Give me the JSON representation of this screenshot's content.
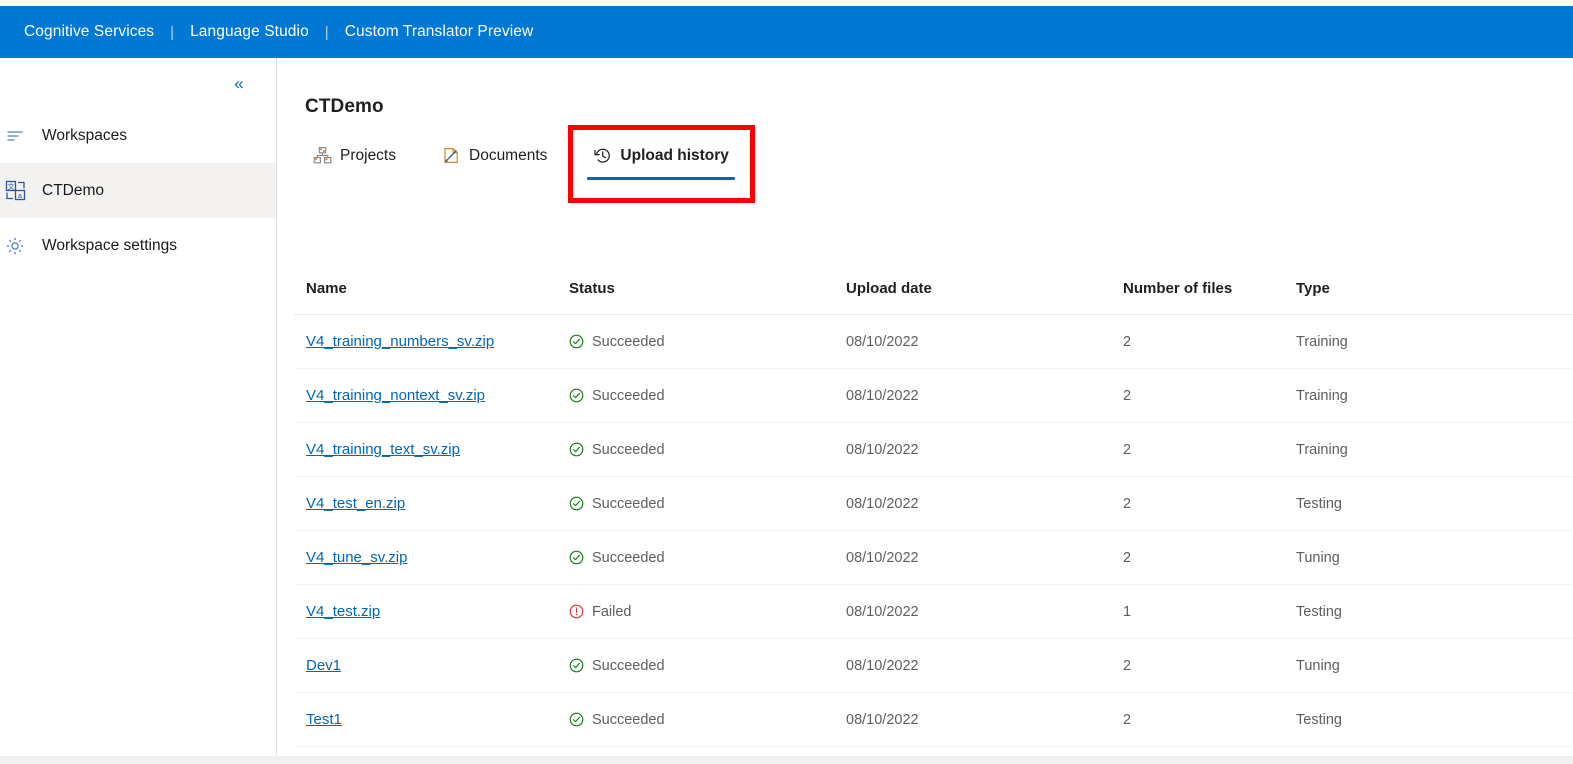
{
  "topbar": {
    "links": [
      "Cognitive Services",
      "Language Studio",
      "Custom Translator Preview"
    ],
    "separator": "|",
    "background": "#0078d4",
    "text_color": "#ffffff"
  },
  "sidebar": {
    "collapse_glyph": "«",
    "items": [
      {
        "label": "Workspaces",
        "icon": "list-icon",
        "selected": false
      },
      {
        "label": "CTDemo",
        "icon": "translate-icon",
        "selected": true
      },
      {
        "label": "Workspace settings",
        "icon": "gear-icon",
        "selected": false
      }
    ]
  },
  "main": {
    "title": "CTDemo",
    "tabs": [
      {
        "label": "Projects",
        "icon": "projects-icon",
        "active": false
      },
      {
        "label": "Documents",
        "icon": "documents-icon",
        "active": false
      },
      {
        "label": "Upload history",
        "icon": "history-icon",
        "active": true
      }
    ],
    "annotation": {
      "color": "#fe0000",
      "target": "Upload history"
    },
    "accent_color": "#0067b8",
    "table": {
      "columns": [
        "Name",
        "Status",
        "Upload date",
        "Number of files",
        "Type"
      ],
      "rows": [
        {
          "name": "V4_training_numbers_sv.zip",
          "status": "Succeeded",
          "status_icon": "check-circle-icon",
          "date": "08/10/2022",
          "files": "2",
          "type": "Training"
        },
        {
          "name": "V4_training_nontext_sv.zip",
          "status": "Succeeded",
          "status_icon": "check-circle-icon",
          "date": "08/10/2022",
          "files": "2",
          "type": "Training"
        },
        {
          "name": "V4_training_text_sv.zip",
          "status": "Succeeded",
          "status_icon": "check-circle-icon",
          "date": "08/10/2022",
          "files": "2",
          "type": "Training"
        },
        {
          "name": "V4_test_en.zip",
          "status": "Succeeded",
          "status_icon": "check-circle-icon",
          "date": "08/10/2022",
          "files": "2",
          "type": "Testing"
        },
        {
          "name": "V4_tune_sv.zip",
          "status": "Succeeded",
          "status_icon": "check-circle-icon",
          "date": "08/10/2022",
          "files": "2",
          "type": "Tuning"
        },
        {
          "name": "V4_test.zip",
          "status": "Failed",
          "status_icon": "error-circle-icon",
          "date": "08/10/2022",
          "files": "1",
          "type": "Testing"
        },
        {
          "name": "Dev1",
          "status": "Succeeded",
          "status_icon": "check-circle-icon",
          "date": "08/10/2022",
          "files": "2",
          "type": "Tuning"
        },
        {
          "name": "Test1",
          "status": "Succeeded",
          "status_icon": "check-circle-icon",
          "date": "08/10/2022",
          "files": "2",
          "type": "Testing"
        }
      ],
      "status_colors": {
        "succeeded": "#107c10",
        "failed": "#d13438"
      }
    }
  }
}
